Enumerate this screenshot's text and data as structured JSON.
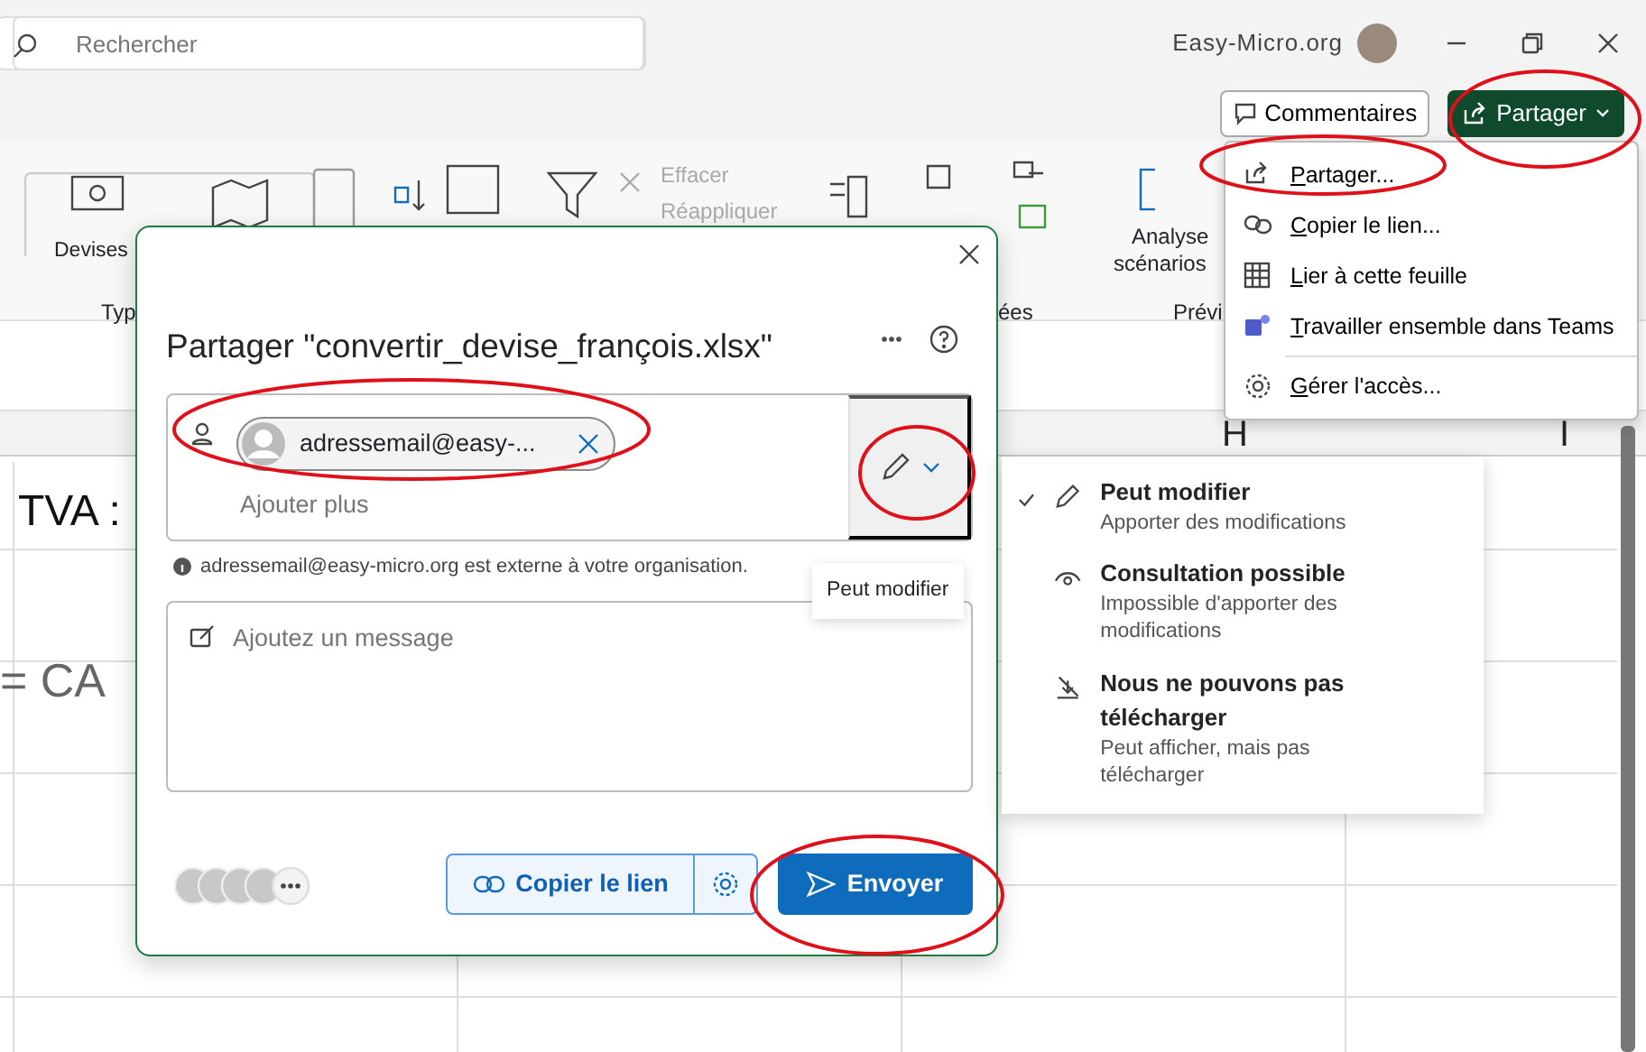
{
  "title_bar": {
    "search": {
      "placeholder": "Rechercher"
    },
    "account": "Easy-Micro.org"
  },
  "header_buttons": [
    {
      "label": "Commentaires",
      "kind": "comments"
    },
    {
      "label": "Partager",
      "kind": "share"
    }
  ],
  "ribbon": {
    "buttons": [
      {
        "label": "Devises",
        "disabled": false
      },
      {
        "label": "Effacer",
        "disabled": true
      },
      {
        "label": "Réappliquer",
        "disabled": true
      },
      {
        "label": "Analyse",
        "disabled": false
      },
      {
        "label": "scénarios",
        "disabled": false
      }
    ],
    "group_labels": [
      "Typ",
      "ées",
      "Prévi"
    ]
  },
  "spreadsheet": {
    "column_headers": [
      "H",
      "I"
    ],
    "cells": [
      "TVA :",
      "= CA"
    ]
  },
  "share_menu": [
    {
      "label": "Partager...",
      "kind": "share"
    },
    {
      "label": "Copier le lien...",
      "kind": "link"
    },
    {
      "label": "Lier à cette feuille",
      "kind": "sheet"
    },
    {
      "label": "Travailler ensemble dans Teams",
      "kind": "teams"
    },
    {
      "label": "Gérer l'accès...",
      "kind": "gear"
    }
  ],
  "dialog": {
    "title": "Partager \"convertir_devise_françois.xlsx\"",
    "recipient": "adressemail@easy-...",
    "add_more": {
      "placeholder": "Ajouter plus"
    },
    "notice": "adressemail@easy-micro.org est externe à votre organisation.",
    "message": {
      "placeholder": "Ajoutez un message"
    },
    "copy_link": "Copier le lien",
    "send": "Envoyer"
  },
  "tooltip": "Peut modifier",
  "permissions": [
    {
      "title": "Peut modifier",
      "description": "Apporter des modifications",
      "kind": "edit",
      "selected": true
    },
    {
      "title": "Consultation possible",
      "description": "Impossible d'apporter des modifications",
      "kind": "view",
      "selected": false
    },
    {
      "title": "Nous ne pouvons pas télécharger",
      "description": "Peut afficher, mais pas télécharger",
      "kind": "nodownload",
      "selected": false
    }
  ]
}
